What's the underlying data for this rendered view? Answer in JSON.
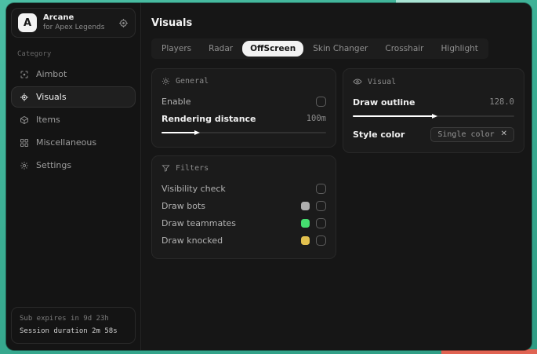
{
  "colors": {
    "background_teal": "#3aae93",
    "background_salmon": "#e06352",
    "active_tab_bg": "#f2f2f2",
    "slider_fill": "#ffffff"
  },
  "window": {
    "sidebar": {
      "logo_letter": "A",
      "app_name": "Arcane",
      "app_subtitle": "for Apex Legends",
      "header_icon": "target-icon",
      "category_label": "Category",
      "items": [
        {
          "label": "Aimbot",
          "icon": "crosshair-icon",
          "active": false
        },
        {
          "label": "Visuals",
          "icon": "eye-scan-icon",
          "active": true
        },
        {
          "label": "Items",
          "icon": "cube-icon",
          "active": false
        },
        {
          "label": "Miscellaneous",
          "icon": "grid-icon",
          "active": false
        },
        {
          "label": "Settings",
          "icon": "gear-icon",
          "active": false
        }
      ],
      "footer": {
        "line1": "Sub expires in 9d 23h",
        "line2": "Session duration 2m 58s"
      }
    },
    "main": {
      "title": "Visuals",
      "tabs": [
        {
          "label": "Players",
          "active": false
        },
        {
          "label": "Radar",
          "active": false
        },
        {
          "label": "OffScreen",
          "active": true
        },
        {
          "label": "Skin Changer",
          "active": false
        },
        {
          "label": "Crosshair",
          "active": false
        },
        {
          "label": "Highlight",
          "active": false
        }
      ],
      "panels": {
        "general": {
          "title": "General",
          "icon": "sun-icon",
          "enable_label": "Enable",
          "enable_checked": false,
          "distance_label": "Rendering distance",
          "distance_value": "100m",
          "distance_percent": "21%"
        },
        "filters": {
          "title": "Filters",
          "icon": "funnel-icon",
          "rows": [
            {
              "label": "Visibility check",
              "swatch": null,
              "checked": false
            },
            {
              "label": "Draw bots",
              "swatch": "#aeaeae",
              "checked": false
            },
            {
              "label": "Draw teammates",
              "swatch": "#45de6f",
              "checked": false
            },
            {
              "label": "Draw knocked",
              "swatch": "#e2c04e",
              "checked": false
            }
          ]
        },
        "visual": {
          "title": "Visual",
          "icon": "eye-icon",
          "outline_label": "Draw outline",
          "outline_value": "128.0",
          "outline_percent": "50%",
          "style_label": "Style color",
          "style_value": "Single color",
          "style_clear_icon": "close-icon"
        }
      }
    }
  }
}
